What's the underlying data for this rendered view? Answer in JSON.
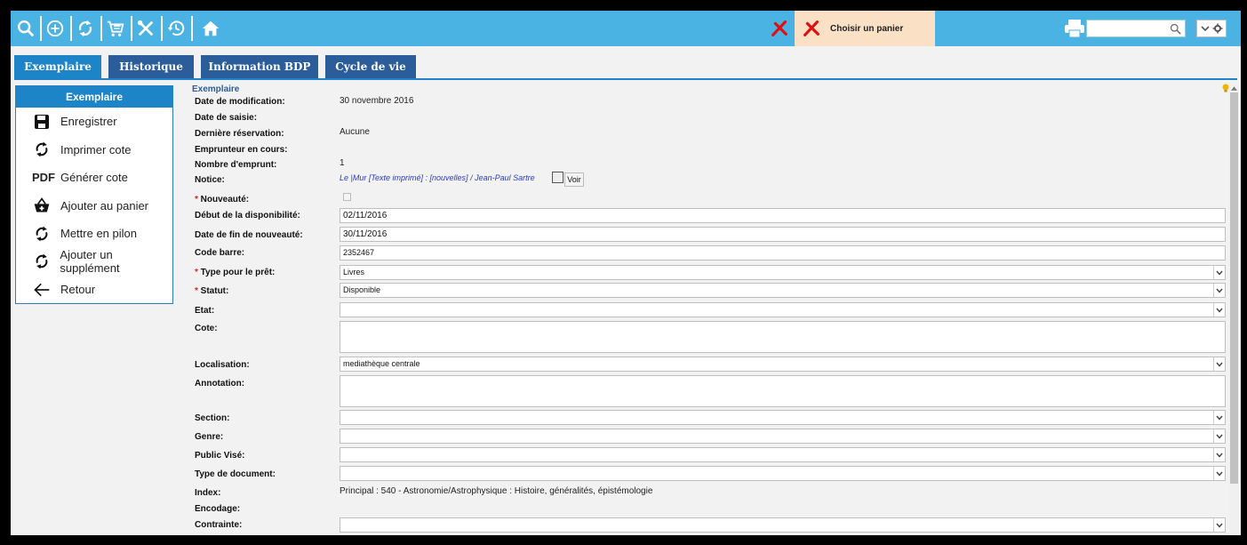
{
  "toolbar": {
    "icons": [
      "search-icon",
      "add-circle-icon",
      "refresh-icon",
      "cart-icon",
      "tools-icon",
      "history-icon",
      "home-icon"
    ],
    "basket_label": "Choisir un panier",
    "search_value": ""
  },
  "tabs": [
    "Exemplaire",
    "Historique",
    "Information BDP",
    "Cycle de vie"
  ],
  "left_menu": {
    "title": "Exemplaire",
    "items": [
      {
        "label": "Enregistrer",
        "icon": "save-icon"
      },
      {
        "label": "Imprimer cote",
        "icon": "refresh-icon"
      },
      {
        "prefix": "PDF",
        "label": "Générer cote",
        "icon": "pdf-icon"
      },
      {
        "label": "Ajouter au panier",
        "icon": "basket-add-icon"
      },
      {
        "label": "Mettre en pilon",
        "icon": "refresh-icon"
      },
      {
        "label": "Ajouter un supplément",
        "icon": "refresh-icon"
      },
      {
        "label": "Retour",
        "icon": "arrow-left-icon"
      }
    ]
  },
  "form": {
    "section": "Exemplaire",
    "date_modification": {
      "label": "Date de modification:",
      "value": "30 novembre 2016"
    },
    "date_saisie": {
      "label": "Date de saisie:",
      "value": ""
    },
    "derniere_reservation": {
      "label": "Dernière réservation:",
      "value": "Aucune"
    },
    "emprunteur": {
      "label": "Emprunteur en cours:",
      "value": ""
    },
    "nombre_emprunt": {
      "label": "Nombre d'emprunt:",
      "value": "1"
    },
    "notice": {
      "label": "Notice:",
      "value": "Le |Mur [Texte imprimé] : [nouvelles] / Jean-Paul Sartre",
      "button": "Voir"
    },
    "nouveaute": {
      "label": "Nouveauté:",
      "checked": false
    },
    "debut_dispo": {
      "label": "Début de la disponibilité:",
      "value": "02/11/2016"
    },
    "fin_nouveaute": {
      "label": "Date de fin de nouveauté:",
      "value": "30/11/2016"
    },
    "code_barre": {
      "label": "Code barre:",
      "value": "2352467"
    },
    "type_pret": {
      "label": "Type pour le prêt:",
      "value": "Livres"
    },
    "statut": {
      "label": "Statut:",
      "value": "Disponible"
    },
    "etat": {
      "label": "Etat:",
      "value": ""
    },
    "cote": {
      "label": "Cote:",
      "value": ""
    },
    "localisation": {
      "label": "Localisation:",
      "value": "mediathèque centrale"
    },
    "annotation": {
      "label": "Annotation:",
      "value": ""
    },
    "section_field": {
      "label": "Section:",
      "value": ""
    },
    "genre": {
      "label": "Genre:",
      "value": ""
    },
    "public_vise": {
      "label": "Public Visé:",
      "value": ""
    },
    "type_document": {
      "label": "Type de document:",
      "value": ""
    },
    "index": {
      "label": "Index:",
      "value": "Principal : 540 - Astronomie/Astrophysique : Histoire, généralités, épistémologie"
    },
    "encodage": {
      "label": "Encodage:",
      "value": ""
    },
    "contrainte": {
      "label": "Contrainte:",
      "value": ""
    }
  },
  "colors": {
    "toolbar": "#4ab3e3",
    "tab": "#2a5d99",
    "tab_active": "#1d84c8",
    "basket_bg": "#fae0c4",
    "required": "#dd2222"
  }
}
